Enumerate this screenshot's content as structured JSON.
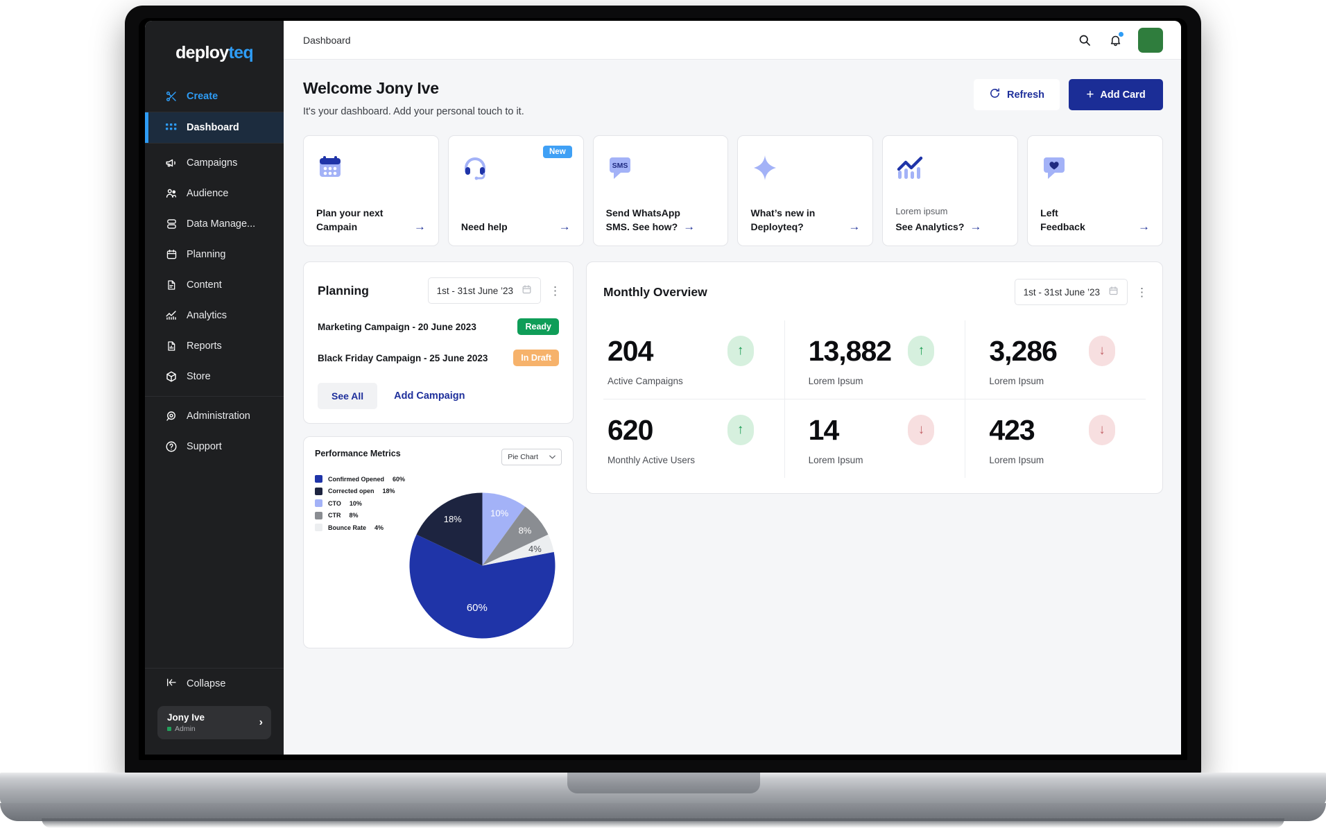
{
  "brand": {
    "name_dark": "deploy",
    "name_accent": "teq"
  },
  "sidebar": {
    "create": {
      "label": "Create",
      "icon": "scissors-icon"
    },
    "active": {
      "label": "Dashboard",
      "icon": "grid-icon"
    },
    "items": [
      {
        "label": "Campaigns",
        "icon": "megaphone-icon"
      },
      {
        "label": "Audience",
        "icon": "users-icon"
      },
      {
        "label": "Data Manage...",
        "icon": "database-icon"
      },
      {
        "label": "Planning",
        "icon": "calendar-icon"
      },
      {
        "label": "Content",
        "icon": "document-icon"
      },
      {
        "label": "Analytics",
        "icon": "chart-line-icon"
      },
      {
        "label": "Reports",
        "icon": "report-icon"
      },
      {
        "label": "Store",
        "icon": "box-icon"
      }
    ],
    "bottom_items": [
      {
        "label": "Administration",
        "icon": "admin-icon"
      },
      {
        "label": "Support",
        "icon": "question-circle-icon"
      }
    ],
    "collapse": {
      "label": "Collapse",
      "icon": "collapse-left-icon"
    },
    "user": {
      "name": "Jony Ive",
      "role": "Admin",
      "chevron": "›"
    }
  },
  "topbar": {
    "breadcrumb": "Dashboard",
    "search_icon": "search-icon",
    "bell_icon": "bell-icon",
    "avatar_color": "#2f7d3d"
  },
  "welcome": {
    "title": "Welcome Jony Ive",
    "subtitle": "It's your dashboard. Add your personal touch to it.",
    "refresh_label": "Refresh",
    "add_card_label": "Add Card",
    "plus": "+"
  },
  "quick_cards": [
    {
      "icon": "calendar-icon",
      "line1": "Plan your next",
      "line2": "Campain",
      "arrow": "→",
      "badge": ""
    },
    {
      "icon": "headset-icon",
      "line1": "Need help",
      "line2": "",
      "arrow": "→",
      "badge": "New"
    },
    {
      "icon": "sms-bubble-icon",
      "line1": "Send WhatsApp",
      "line2": "SMS. See how?",
      "arrow": "→",
      "badge": ""
    },
    {
      "icon": "sparkle-icon",
      "line1": "What’s new in",
      "line2": "Deployteq?",
      "arrow": "→",
      "badge": ""
    },
    {
      "icon": "analytics-bars-icon",
      "line1": "Lorem ipsum",
      "line2": "See Analytics?",
      "arrow": "→",
      "badge": ""
    },
    {
      "icon": "heart-bubble-icon",
      "line1": "Left",
      "line2": "Feedback",
      "arrow": "→",
      "badge": ""
    }
  ],
  "planning": {
    "title": "Planning",
    "date_range": "1st - 31st June ’23",
    "kebab": "⋮",
    "rows": [
      {
        "label": "Marketing Campaign - 20 June 2023",
        "status": "Ready"
      },
      {
        "label": "Black Friday Campaign - 25 June 2023",
        "status": "In Draft"
      }
    ],
    "see_all": "See All",
    "add_campaign": "Add Campaign"
  },
  "monthly_overview": {
    "title": "Monthly Overview",
    "date_range": "1st - 31st June ’23",
    "kebab": "⋮",
    "stats": [
      {
        "value": "204",
        "label": "Active Campaigns",
        "trend": "up",
        "arrow": "↑"
      },
      {
        "value": "13,882",
        "label": "Lorem Ipsum",
        "trend": "up",
        "arrow": "↑"
      },
      {
        "value": "3,286",
        "label": "Lorem Ipsum",
        "trend": "down",
        "arrow": "↓"
      },
      {
        "value": "620",
        "label": "Monthly Active Users",
        "trend": "up",
        "arrow": "↑"
      },
      {
        "value": "14",
        "label": "Lorem Ipsum",
        "trend": "down",
        "arrow": "↓"
      },
      {
        "value": "423",
        "label": "Lorem Ipsum",
        "trend": "down",
        "arrow": "↓"
      }
    ]
  },
  "performance": {
    "title": "Performance Metrics",
    "selected_type": "Pie Chart",
    "chevron": "⌄"
  },
  "chart_data": {
    "type": "pie",
    "title": "Performance Metrics",
    "legend_position": "left",
    "categories": [
      "Confirmed Opened",
      "Corrected open",
      "CTO",
      "CTR",
      "Bounce Rate"
    ],
    "values": [
      60,
      18,
      10,
      8,
      4
    ],
    "labels": [
      "60%",
      "18%",
      "10%",
      "8%",
      "4%"
    ],
    "colors": [
      "#1f34a8",
      "#1d2440",
      "#a3b2f7",
      "#8a8d92",
      "#eceef0"
    ],
    "unit": "%"
  },
  "theme": {
    "accent_blue": "#2E9CF5",
    "primary_navy": "#1b2d96",
    "sidebar_bg": "#1e1f21",
    "ready_green": "#0f9d58",
    "draft_orange": "#f6b26b"
  }
}
